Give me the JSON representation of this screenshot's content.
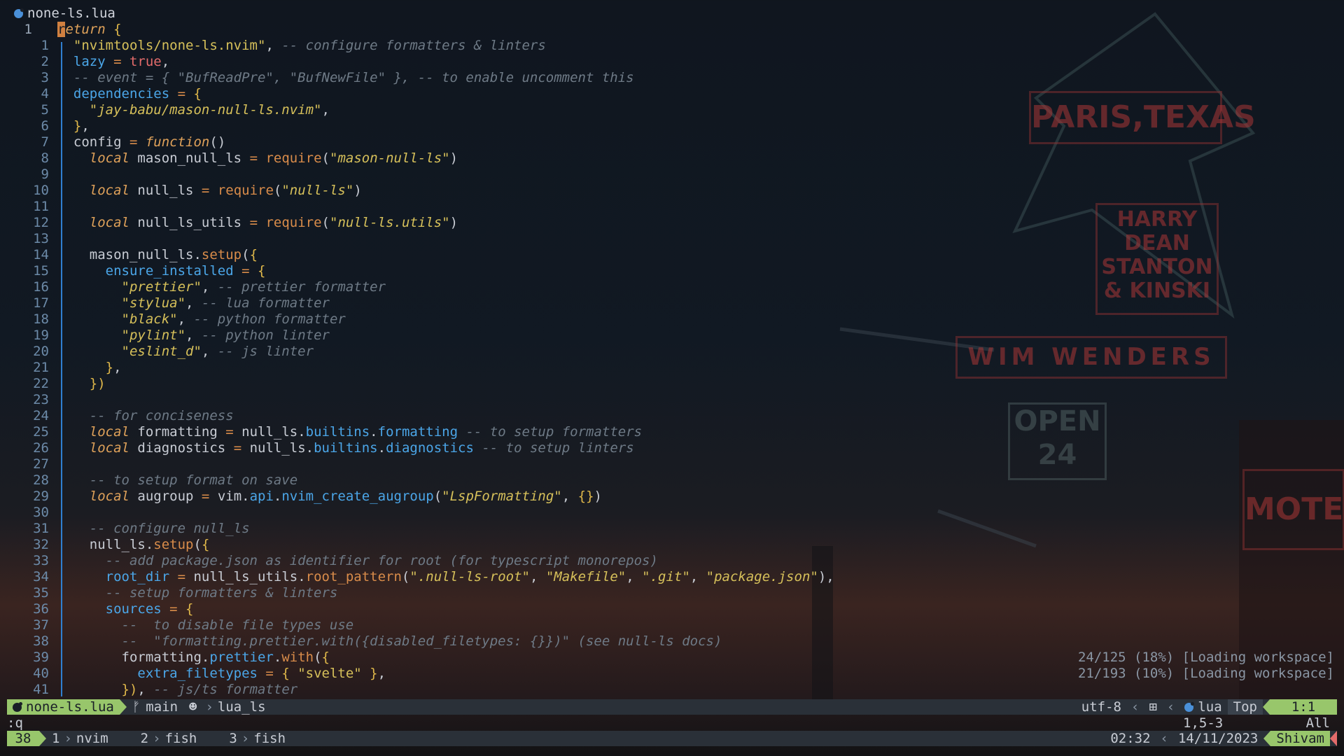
{
  "tab": {
    "filename": "none-ls.lua",
    "icon": "lua-icon"
  },
  "cursor_line_number": "1",
  "lines": [
    {
      "n": "1",
      "tokens": [
        [
          "cursor",
          "r"
        ],
        [
          "kw",
          "eturn"
        ],
        [
          "txt",
          " "
        ],
        [
          "brace",
          "{"
        ]
      ]
    },
    {
      "n": "1",
      "tokens": [
        [
          "txt",
          "  "
        ],
        [
          "str",
          "\"nvimtools/none-ls.nvim\""
        ],
        [
          "txt",
          ", "
        ],
        [
          "cmt",
          "-- configure formatters & linters"
        ]
      ]
    },
    {
      "n": "2",
      "tokens": [
        [
          "txt",
          "  "
        ],
        [
          "key",
          "lazy"
        ],
        [
          "op",
          " = "
        ],
        [
          "bool",
          "true"
        ],
        [
          "txt",
          ","
        ]
      ]
    },
    {
      "n": "3",
      "tokens": [
        [
          "txt",
          "  "
        ],
        [
          "cmt",
          "-- event = { \"BufReadPre\", \"BufNewFile\" }, -- to enable uncomment this"
        ]
      ]
    },
    {
      "n": "4",
      "tokens": [
        [
          "txt",
          "  "
        ],
        [
          "key",
          "dependencies"
        ],
        [
          "op",
          " = "
        ],
        [
          "brace",
          "{"
        ]
      ]
    },
    {
      "n": "5",
      "tokens": [
        [
          "txt",
          "    "
        ],
        [
          "strI",
          "\"jay-babu/mason-null-ls.nvim\""
        ],
        [
          "txt",
          ","
        ]
      ]
    },
    {
      "n": "6",
      "tokens": [
        [
          "txt",
          "  "
        ],
        [
          "brace",
          "}"
        ],
        [
          "txt",
          ","
        ]
      ]
    },
    {
      "n": "7",
      "tokens": [
        [
          "txt",
          "  config "
        ],
        [
          "op",
          "="
        ],
        [
          "txt",
          " "
        ],
        [
          "fn",
          "function"
        ],
        [
          "txt",
          "()"
        ]
      ]
    },
    {
      "n": "8",
      "tokens": [
        [
          "txt",
          "    "
        ],
        [
          "kw",
          "local"
        ],
        [
          "txt",
          " mason_null_ls "
        ],
        [
          "op",
          "="
        ],
        [
          "txt",
          " "
        ],
        [
          "mth",
          "require"
        ],
        [
          "txt",
          "("
        ],
        [
          "strI",
          "\"mason-null-ls\""
        ],
        [
          "txt",
          ")"
        ]
      ]
    },
    {
      "n": "9",
      "tokens": []
    },
    {
      "n": "10",
      "tokens": [
        [
          "txt",
          "    "
        ],
        [
          "kw",
          "local"
        ],
        [
          "txt",
          " null_ls "
        ],
        [
          "op",
          "="
        ],
        [
          "txt",
          " "
        ],
        [
          "mth",
          "require"
        ],
        [
          "txt",
          "("
        ],
        [
          "strI",
          "\"null-ls\""
        ],
        [
          "txt",
          ")"
        ]
      ]
    },
    {
      "n": "11",
      "tokens": []
    },
    {
      "n": "12",
      "tokens": [
        [
          "txt",
          "    "
        ],
        [
          "kw",
          "local"
        ],
        [
          "txt",
          " null_ls_utils "
        ],
        [
          "op",
          "="
        ],
        [
          "txt",
          " "
        ],
        [
          "mth",
          "require"
        ],
        [
          "txt",
          "("
        ],
        [
          "strI",
          "\"null-ls.utils\""
        ],
        [
          "txt",
          ")"
        ]
      ]
    },
    {
      "n": "13",
      "tokens": []
    },
    {
      "n": "14",
      "tokens": [
        [
          "txt",
          "    mason_null_ls."
        ],
        [
          "mth",
          "setup"
        ],
        [
          "txt",
          "("
        ],
        [
          "brace",
          "{"
        ]
      ]
    },
    {
      "n": "15",
      "tokens": [
        [
          "txt",
          "      "
        ],
        [
          "key",
          "ensure_installed"
        ],
        [
          "op",
          " = "
        ],
        [
          "brace",
          "{"
        ]
      ]
    },
    {
      "n": "16",
      "tokens": [
        [
          "txt",
          "        "
        ],
        [
          "strI",
          "\"prettier\""
        ],
        [
          "txt",
          ", "
        ],
        [
          "cmt",
          "-- prettier formatter"
        ]
      ]
    },
    {
      "n": "17",
      "tokens": [
        [
          "txt",
          "        "
        ],
        [
          "strI",
          "\"stylua\""
        ],
        [
          "txt",
          ", "
        ],
        [
          "cmt",
          "-- lua formatter"
        ]
      ]
    },
    {
      "n": "18",
      "tokens": [
        [
          "txt",
          "        "
        ],
        [
          "strI",
          "\"black\""
        ],
        [
          "txt",
          ", "
        ],
        [
          "cmt",
          "-- python formatter"
        ]
      ]
    },
    {
      "n": "19",
      "tokens": [
        [
          "txt",
          "        "
        ],
        [
          "strI",
          "\"pylint\""
        ],
        [
          "txt",
          ", "
        ],
        [
          "cmt",
          "-- python linter"
        ]
      ]
    },
    {
      "n": "20",
      "tokens": [
        [
          "txt",
          "        "
        ],
        [
          "strI",
          "\"eslint_d\""
        ],
        [
          "txt",
          ", "
        ],
        [
          "cmt",
          "-- js linter"
        ]
      ]
    },
    {
      "n": "21",
      "tokens": [
        [
          "txt",
          "      "
        ],
        [
          "brace",
          "}"
        ],
        [
          "txt",
          ","
        ]
      ]
    },
    {
      "n": "22",
      "tokens": [
        [
          "txt",
          "    "
        ],
        [
          "brace",
          "})"
        ]
      ]
    },
    {
      "n": "23",
      "tokens": []
    },
    {
      "n": "24",
      "tokens": [
        [
          "txt",
          "    "
        ],
        [
          "cmt",
          "-- for conciseness"
        ]
      ]
    },
    {
      "n": "25",
      "tokens": [
        [
          "txt",
          "    "
        ],
        [
          "kw",
          "local"
        ],
        [
          "txt",
          " formatting "
        ],
        [
          "op",
          "="
        ],
        [
          "txt",
          " null_ls."
        ],
        [
          "fld",
          "builtins"
        ],
        [
          "txt",
          "."
        ],
        [
          "fld",
          "formatting"
        ],
        [
          "txt",
          " "
        ],
        [
          "cmt",
          "-- to setup formatters"
        ]
      ]
    },
    {
      "n": "26",
      "tokens": [
        [
          "txt",
          "    "
        ],
        [
          "kw",
          "local"
        ],
        [
          "txt",
          " diagnostics "
        ],
        [
          "op",
          "="
        ],
        [
          "txt",
          " null_ls."
        ],
        [
          "fld",
          "builtins"
        ],
        [
          "txt",
          "."
        ],
        [
          "fld",
          "diagnostics"
        ],
        [
          "txt",
          " "
        ],
        [
          "cmt",
          "-- to setup linters"
        ]
      ]
    },
    {
      "n": "27",
      "tokens": []
    },
    {
      "n": "28",
      "tokens": [
        [
          "txt",
          "    "
        ],
        [
          "cmt",
          "-- to setup format on save"
        ]
      ]
    },
    {
      "n": "29",
      "tokens": [
        [
          "txt",
          "    "
        ],
        [
          "kw",
          "local"
        ],
        [
          "txt",
          " augroup "
        ],
        [
          "op",
          "="
        ],
        [
          "txt",
          " vim."
        ],
        [
          "fld",
          "api"
        ],
        [
          "txt",
          "."
        ],
        [
          "fld",
          "nvim_create_augroup"
        ],
        [
          "txt",
          "("
        ],
        [
          "strI",
          "\"LspFormatting\""
        ],
        [
          "txt",
          ", "
        ],
        [
          "brace",
          "{}"
        ],
        [
          "txt",
          ")"
        ]
      ]
    },
    {
      "n": "30",
      "tokens": []
    },
    {
      "n": "31",
      "tokens": [
        [
          "txt",
          "    "
        ],
        [
          "cmt",
          "-- configure null_ls"
        ]
      ]
    },
    {
      "n": "32",
      "tokens": [
        [
          "txt",
          "    null_ls."
        ],
        [
          "mth",
          "setup"
        ],
        [
          "txt",
          "("
        ],
        [
          "brace",
          "{"
        ]
      ]
    },
    {
      "n": "33",
      "tokens": [
        [
          "txt",
          "      "
        ],
        [
          "cmt",
          "-- add package.json as identifier for root (for typescript monorepos)"
        ]
      ]
    },
    {
      "n": "34",
      "tokens": [
        [
          "txt",
          "      "
        ],
        [
          "key",
          "root_dir"
        ],
        [
          "op",
          " = "
        ],
        [
          "txt",
          "null_ls_utils."
        ],
        [
          "mth",
          "root_pattern"
        ],
        [
          "txt",
          "("
        ],
        [
          "strI",
          "\".null-ls-root\""
        ],
        [
          "txt",
          ", "
        ],
        [
          "strI",
          "\"Makefile\""
        ],
        [
          "txt",
          ", "
        ],
        [
          "strI",
          "\".git\""
        ],
        [
          "txt",
          ", "
        ],
        [
          "strI",
          "\"package.json\""
        ],
        [
          "txt",
          "),"
        ]
      ]
    },
    {
      "n": "35",
      "tokens": [
        [
          "txt",
          "      "
        ],
        [
          "cmt",
          "-- setup formatters & linters"
        ]
      ]
    },
    {
      "n": "36",
      "tokens": [
        [
          "txt",
          "      "
        ],
        [
          "key",
          "sources"
        ],
        [
          "op",
          " = "
        ],
        [
          "brace",
          "{"
        ]
      ]
    },
    {
      "n": "37",
      "tokens": [
        [
          "txt",
          "        "
        ],
        [
          "cmt",
          "--  to disable file types use"
        ]
      ]
    },
    {
      "n": "38",
      "tokens": [
        [
          "txt",
          "        "
        ],
        [
          "cmt",
          "--  \"formatting.prettier.with({disabled_filetypes: {}})\" (see null-ls docs)"
        ]
      ]
    },
    {
      "n": "39",
      "tokens": [
        [
          "txt",
          "        formatting."
        ],
        [
          "fld",
          "prettier"
        ],
        [
          "txt",
          "."
        ],
        [
          "mth",
          "with"
        ],
        [
          "txt",
          "("
        ],
        [
          "brace",
          "{"
        ]
      ]
    },
    {
      "n": "40",
      "tokens": [
        [
          "txt",
          "          "
        ],
        [
          "key",
          "extra_filetypes"
        ],
        [
          "op",
          " = "
        ],
        [
          "brace",
          "{ "
        ],
        [
          "str",
          "\"svelte\""
        ],
        [
          "brace",
          " }"
        ],
        [
          "txt",
          ","
        ]
      ]
    },
    {
      "n": "41",
      "tokens": [
        [
          "txt",
          "        "
        ],
        [
          "brace",
          "})"
        ],
        [
          "txt",
          ", "
        ],
        [
          "cmt",
          "-- js/ts formatter"
        ]
      ]
    }
  ],
  "lsp_progress": [
    "24/125 (18%) [Loading workspace]",
    "21/193 (10%) [Loading workspace]"
  ],
  "lsp_name": "lua_ls",
  "statusline": {
    "file": "none-ls.lua",
    "branch": "main",
    "lsp": "lua_ls",
    "encoding": "utf-8",
    "filetype": "lua",
    "position_word": "Top",
    "cursor_pos": "1:1"
  },
  "cmdline": {
    "command": ":q",
    "ruler": "1,5-3",
    "scroll": "All"
  },
  "tmux": {
    "session": "38",
    "windows": [
      {
        "index": "1",
        "name": "nvim"
      },
      {
        "index": "2",
        "name": "fish"
      },
      {
        "index": "3",
        "name": "fish"
      }
    ],
    "time": "02:32",
    "date": "14/11/2023",
    "user": "Shivam"
  },
  "colors": {
    "accent_green": "#98c66b",
    "gutter_blue": "#2f7fd0",
    "lua_blue": "#4a90d9"
  }
}
